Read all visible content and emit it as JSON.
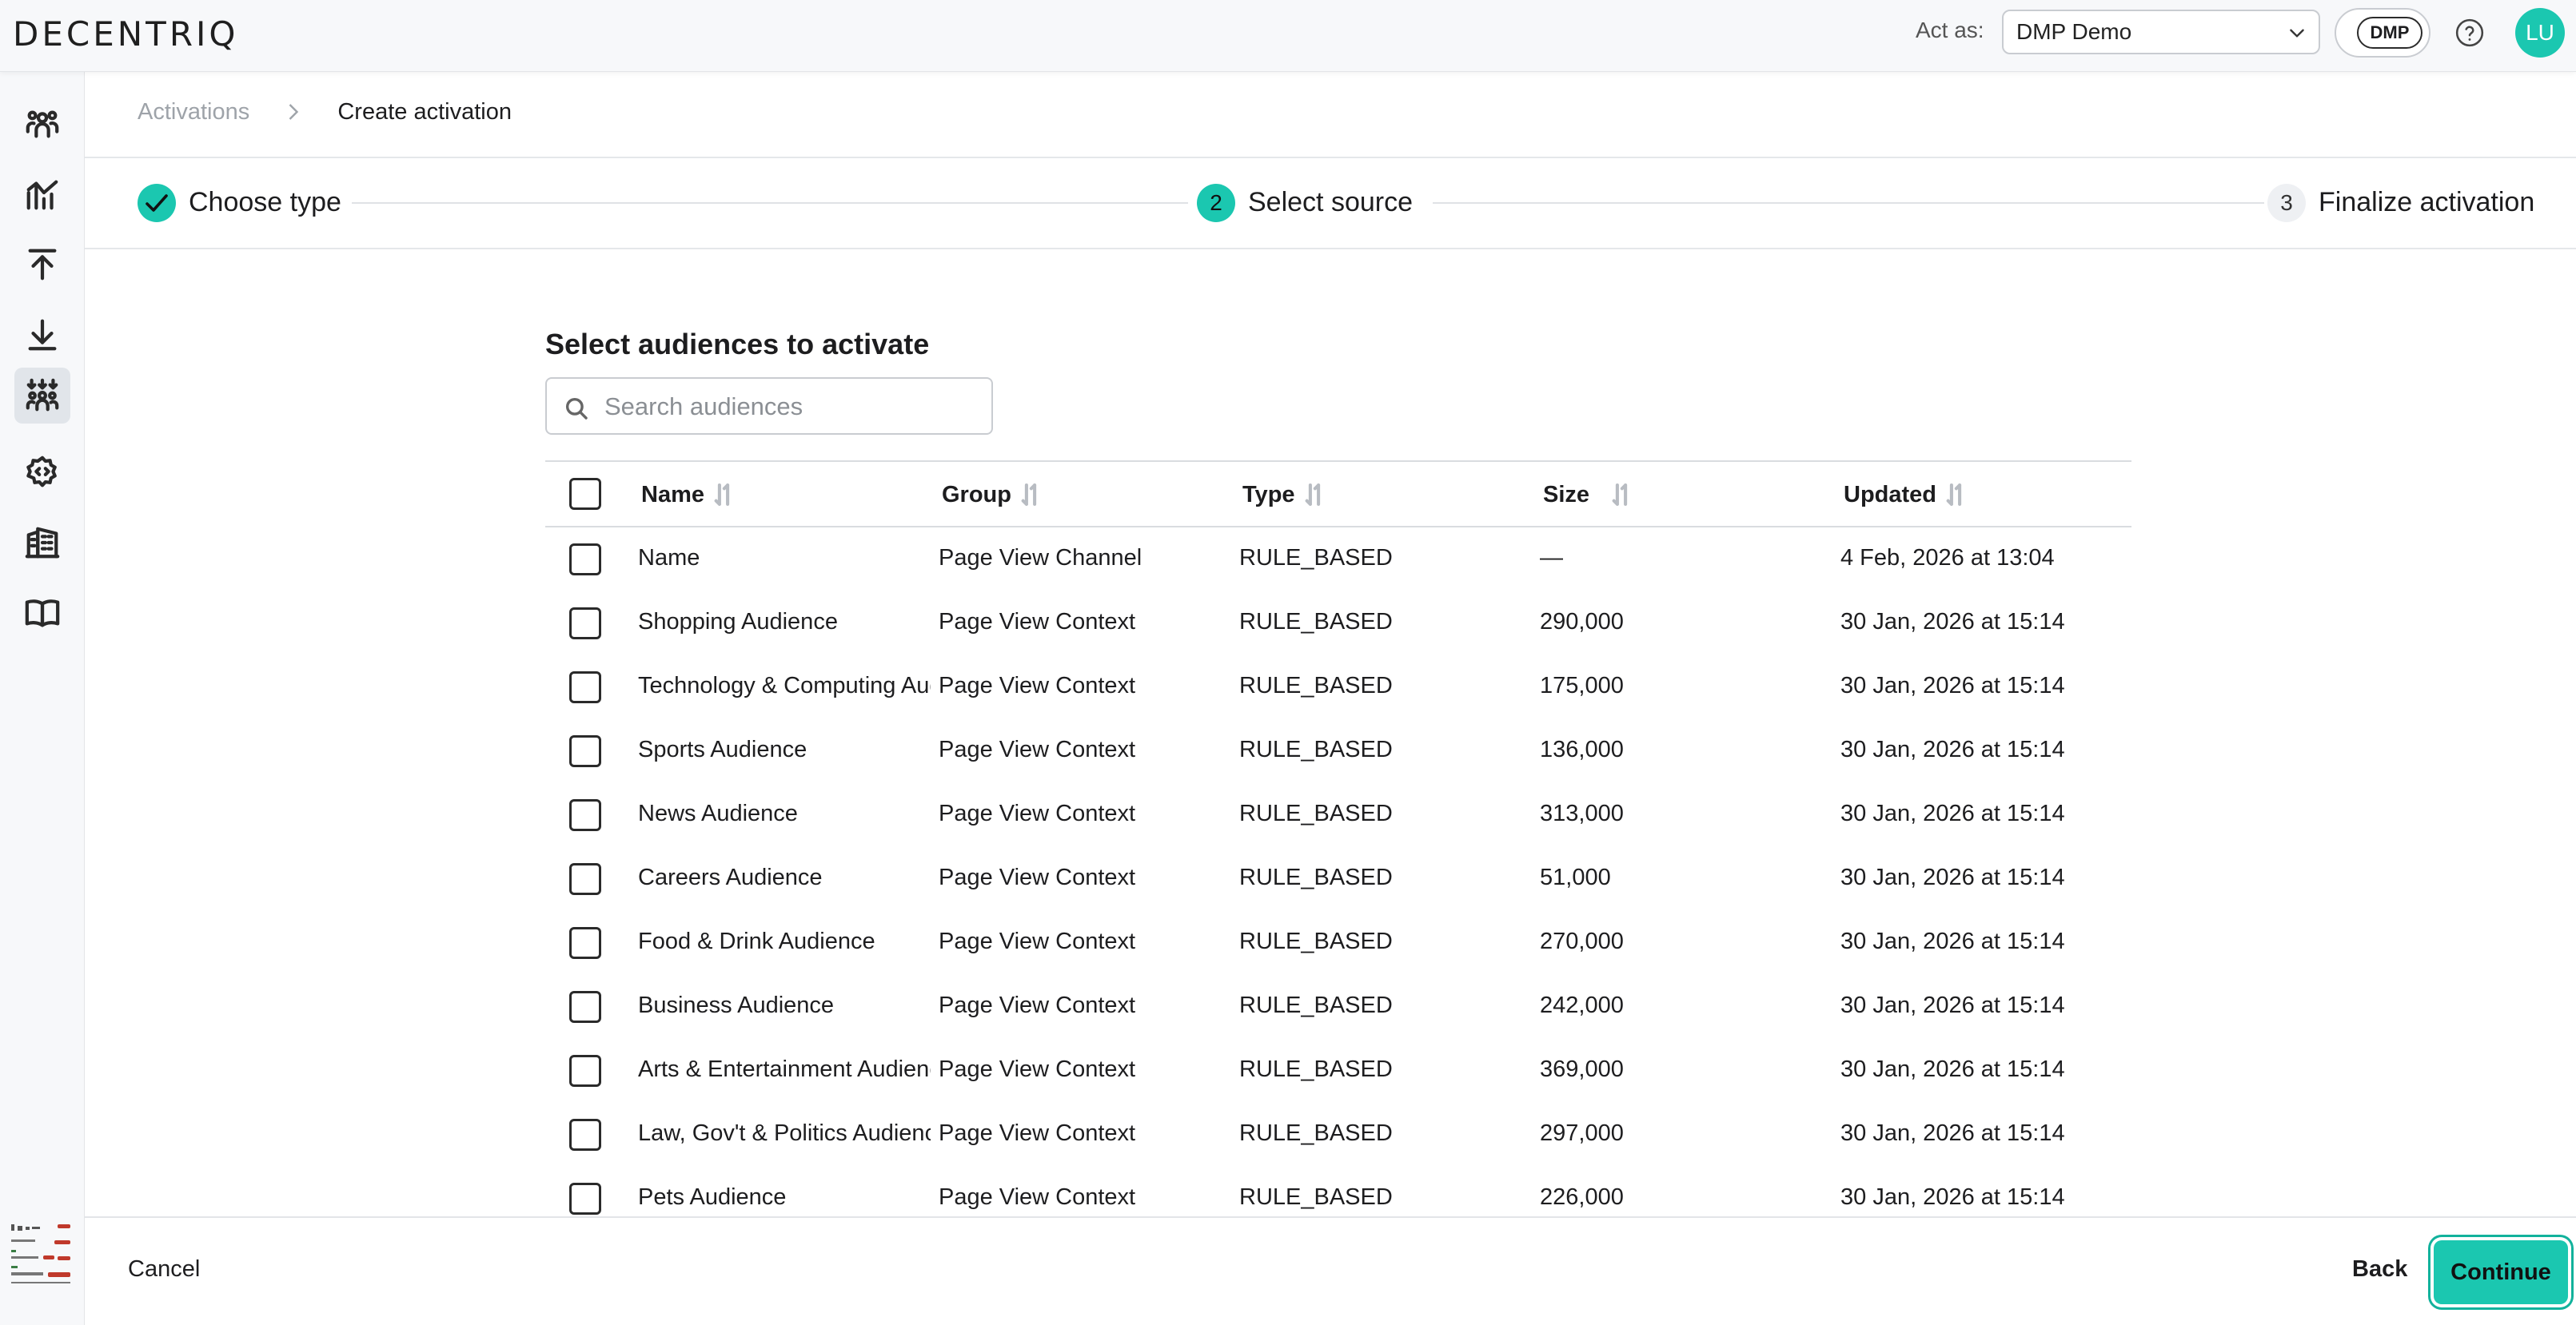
{
  "app": {
    "logo": "DECENTRIQ"
  },
  "header": {
    "act_as_label": "Act as:",
    "act_as_value": "DMP Demo",
    "org_badge": "DMP",
    "avatar_initials": "LU"
  },
  "sidebar": {
    "items": [
      {
        "icon": "audience-people-icon"
      },
      {
        "icon": "insights-chart-icon"
      },
      {
        "icon": "upload-icon"
      },
      {
        "icon": "download-icon"
      },
      {
        "icon": "activations-icon",
        "active": true
      },
      {
        "icon": "developer-gear-icon"
      },
      {
        "icon": "organizations-building-icon"
      },
      {
        "icon": "documentation-book-icon"
      }
    ],
    "expand_icon": "double-chevron-right-icon"
  },
  "breadcrumb": {
    "parent": "Activations",
    "current": "Create activation"
  },
  "stepper": {
    "steps": [
      {
        "number": "1",
        "label": "Choose type",
        "status": "done"
      },
      {
        "number": "2",
        "label": "Select source",
        "status": "active"
      },
      {
        "number": "3",
        "label": "Finalize activation",
        "status": "pending"
      }
    ]
  },
  "main": {
    "title": "Select audiences to activate",
    "search_placeholder": "Search audiences",
    "columns": [
      "Name",
      "Group",
      "Type",
      "Size",
      "Updated"
    ],
    "rows": [
      {
        "name": "Name",
        "group": "Page View Channel",
        "type": "RULE_BASED",
        "size": "—",
        "updated": "4 Feb, 2026 at 13:04"
      },
      {
        "name": "Shopping Audience",
        "group": "Page View Context",
        "type": "RULE_BASED",
        "size": "290,000",
        "updated": "30 Jan, 2026 at 15:14"
      },
      {
        "name": "Technology & Computing Audience",
        "group": "Page View Context",
        "type": "RULE_BASED",
        "size": "175,000",
        "updated": "30 Jan, 2026 at 15:14"
      },
      {
        "name": "Sports Audience",
        "group": "Page View Context",
        "type": "RULE_BASED",
        "size": "136,000",
        "updated": "30 Jan, 2026 at 15:14"
      },
      {
        "name": "News Audience",
        "group": "Page View Context",
        "type": "RULE_BASED",
        "size": "313,000",
        "updated": "30 Jan, 2026 at 15:14"
      },
      {
        "name": "Careers Audience",
        "group": "Page View Context",
        "type": "RULE_BASED",
        "size": "51,000",
        "updated": "30 Jan, 2026 at 15:14"
      },
      {
        "name": "Food & Drink Audience",
        "group": "Page View Context",
        "type": "RULE_BASED",
        "size": "270,000",
        "updated": "30 Jan, 2026 at 15:14"
      },
      {
        "name": "Business Audience",
        "group": "Page View Context",
        "type": "RULE_BASED",
        "size": "242,000",
        "updated": "30 Jan, 2026 at 15:14"
      },
      {
        "name": "Arts & Entertainment Audience",
        "group": "Page View Context",
        "type": "RULE_BASED",
        "size": "369,000",
        "updated": "30 Jan, 2026 at 15:14"
      },
      {
        "name": "Law, Gov't & Politics Audience",
        "group": "Page View Context",
        "type": "RULE_BASED",
        "size": "297,000",
        "updated": "30 Jan, 2026 at 15:14"
      },
      {
        "name": "Pets Audience",
        "group": "Page View Context",
        "type": "RULE_BASED",
        "size": "226,000",
        "updated": "30 Jan, 2026 at 15:14"
      }
    ]
  },
  "footer": {
    "cancel_label": "Cancel",
    "back_label": "Back",
    "continue_label": "Continue"
  },
  "colors": {
    "accent": "#1bc7b0",
    "accent_border": "#12b29c"
  }
}
